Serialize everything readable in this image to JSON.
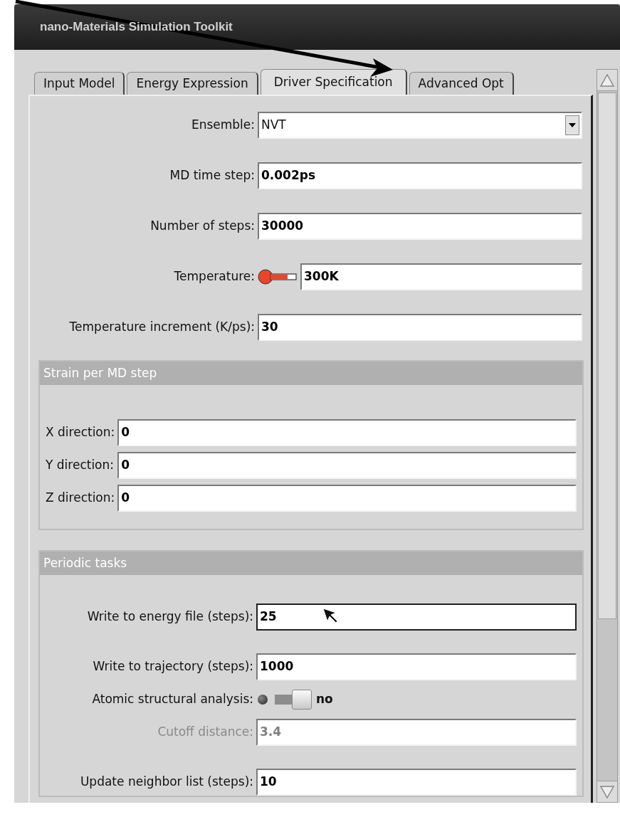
{
  "window": {
    "title": "nano-Materials Simulation Toolkit"
  },
  "tabs": [
    {
      "label": "Input Model",
      "selected": false
    },
    {
      "label": "Energy Expression",
      "selected": false
    },
    {
      "label": "Driver Specification",
      "selected": true
    },
    {
      "label": "Advanced Opt",
      "selected": false
    }
  ],
  "fields": [
    {
      "kind": "dropdown",
      "label": "Ensemble:",
      "value": "NVT"
    },
    {
      "kind": "text",
      "label": "MD time step:",
      "value": "0.002ps"
    },
    {
      "kind": "text",
      "label": "Number of steps:",
      "value": "30000"
    },
    {
      "kind": "temperature",
      "label": "Temperature:",
      "value": "300K"
    },
    {
      "kind": "text",
      "label": "Temperature increment (K/ps):",
      "value": "30"
    }
  ],
  "groups": [
    {
      "title": "Strain per MD step",
      "fields": [
        {
          "kind": "text",
          "label": "X direction:",
          "value": "0"
        },
        {
          "kind": "text",
          "label": "Y direction:",
          "value": "0"
        },
        {
          "kind": "text",
          "label": "Z direction:",
          "value": "0"
        }
      ]
    },
    {
      "title": "Periodic tasks",
      "fields": [
        {
          "kind": "text",
          "label": "Write to energy file (steps):",
          "value": "25",
          "focused": true
        },
        {
          "kind": "text",
          "label": "Write to trajectory (steps):",
          "value": "1000"
        },
        {
          "kind": "toggle",
          "label": "Atomic structural analysis:",
          "on": false,
          "value": "no"
        },
        {
          "kind": "text",
          "label": "Cutoff distance:",
          "value": "3.4",
          "disabled": true
        },
        {
          "kind": "text",
          "label": "Update neighbor list (steps):",
          "value": "10"
        }
      ]
    }
  ]
}
